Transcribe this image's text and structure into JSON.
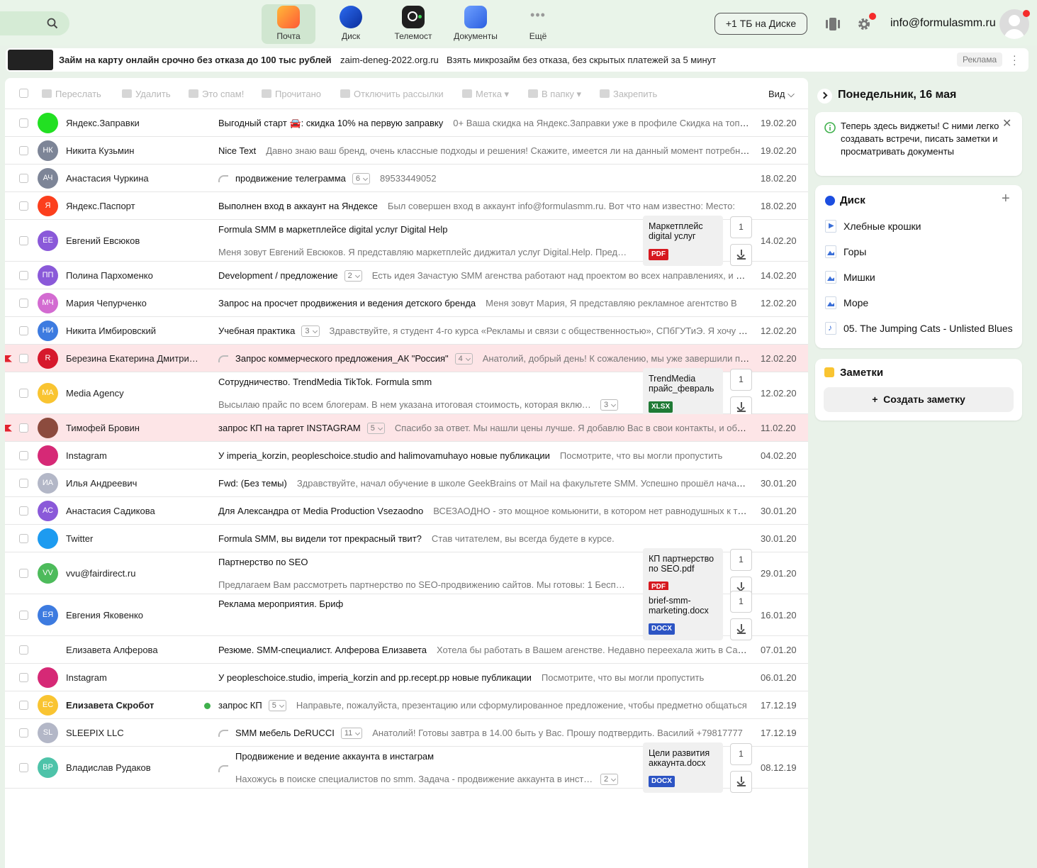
{
  "header": {
    "apps": [
      {
        "label": "Почта",
        "icon": "mail-icon",
        "active": true,
        "color": "#ff8a3d"
      },
      {
        "label": "Диск",
        "icon": "disk-icon",
        "active": false,
        "color": "#1c4ee0"
      },
      {
        "label": "Телемост",
        "icon": "telemost-icon",
        "active": false,
        "color": "#1f1f1f"
      },
      {
        "label": "Документы",
        "icon": "documents-icon",
        "active": false,
        "color": "#4c7cf2"
      },
      {
        "label": "Ещё",
        "icon": "more-dots-icon",
        "active": false,
        "color": "#999999"
      }
    ],
    "disk_offer": "+1 ТБ на Диске",
    "email": "info@formulasmm.ru"
  },
  "ad": {
    "title": "Займ на карту онлайн срочно без отказа до 100 тыс рублей",
    "domain": "zaim-deneg-2022.org.ru",
    "text": "Взять микрозайм без отказа, без скрытых платежей за 5 минут",
    "label": "Реклама"
  },
  "toolbar": {
    "forward": "Переслать",
    "delete": "Удалить",
    "spam": "Это спам!",
    "read": "Прочитано",
    "unsubscribe": "Отключить рассылки",
    "label": "Метка",
    "folder": "В папку",
    "pin": "Закрепить",
    "view": "Вид"
  },
  "emails": [
    {
      "sender": "Яндекс.Заправки",
      "subject": "Выгодный старт 🚘: скидка 10% на первую заправку",
      "snippet": "0+ Ваша скидка на Яндекс.Заправки уже в профиле Скидка на топливо",
      "date": "19.02.20",
      "initials": "",
      "avatar_color": "#22e022"
    },
    {
      "sender": "Никита Кузьмин",
      "subject": "Nice Text",
      "snippet": "Давно знаю ваш бренд, очень классные подходы и решения! Скажите, имеется ли на данный момент потребность",
      "date": "19.02.20",
      "initials": "НК",
      "avatar_color": "#7d8597"
    },
    {
      "sender": "Анастасия Чуркина",
      "subject": "продвижение телеграмма",
      "count": "6",
      "snippet": "89533449052",
      "date": "18.02.20",
      "initials": "АЧ",
      "avatar_color": "#7d8597",
      "reply": true
    },
    {
      "sender": "Яндекс.Паспорт",
      "subject": "Выполнен вход в аккаунт на Яндексе",
      "snippet": "Был совершен вход в аккаунт info@formulasmm.ru. Вот что нам известно: Место:",
      "date": "18.02.20",
      "initials": "Я",
      "avatar_color": "#fc3f1d"
    },
    {
      "sender": "Евгений Евсюков",
      "subject": "Formula SMM в маркетплейсе digital услуг Digital Help",
      "snippet": "Меня зовут Евгений Евсюков. Я представляю маркетплейс диджитал услуг Digital.Help. Предлагаем",
      "date": "14.02.20",
      "initials": "ЕЕ",
      "avatar_color": "#8a59d9",
      "attachment": {
        "name": "Маркетплейс digital услуг",
        "type": "PDF",
        "count": "1"
      }
    },
    {
      "sender": "Полина Пархоменко",
      "subject": "Development / предложение",
      "count": "2",
      "snippet": "Есть идея Зачастую SMM агенства работают над проектом во всех направлениях, и иногда",
      "date": "14.02.20",
      "initials": "ПП",
      "avatar_color": "#8a59d9"
    },
    {
      "sender": "Мария Чепурченко",
      "subject": "Запрос на просчет продвижения и ведения детского бренда",
      "snippet": "Меня зовут Мария, Я представляю рекламное агентство В",
      "date": "12.02.20",
      "initials": "МЧ",
      "avatar_color": "#d36bd1"
    },
    {
      "sender": "Никита Имбировский",
      "subject": "Учебная практика",
      "count": "3",
      "snippet": "Здравствуйте, я студент 4-го курса «Рекламы и связи с общественностью», СПбГУТиЭ. Я хочу пройти",
      "date": "12.02.20",
      "initials": "НИ",
      "avatar_color": "#3d7be0"
    },
    {
      "sender": "Березина Екатерина Дмитриевна",
      "subject": "Запрос коммерческого предложения_АК \"Россия\"",
      "count": "4",
      "snippet": "Анатолий, добрый день! К сожалению, мы уже завершили прием",
      "date": "12.02.20",
      "initials": "R",
      "avatar_color": "#d6182c",
      "reply": true,
      "flag": true,
      "red": true
    },
    {
      "sender": "Media Agency",
      "subject": "Сотрудничество. TrendMedia TikTok. Formula smm",
      "snippet": "Высылаю прайс по всем блогерам. В нем указана итоговая стоимость, которая включает",
      "count": "3",
      "date": "12.02.20",
      "initials": "MA",
      "avatar_color": "#f9c431",
      "attachment": {
        "name": "TrendMedia прайс_февраль",
        "type": "XLSX",
        "count": "1"
      }
    },
    {
      "sender": "Тимофей Бровин",
      "subject": "запрос КП на таргет INSTAGRAM",
      "count": "5",
      "snippet": "Спасибо за ответ. Мы нашли цены лучше. Я добавлю Вас в свои контакты, и обращусь",
      "date": "11.02.20",
      "initials": "",
      "avatar_color": "#8c4b3e",
      "flag": true,
      "red": true
    },
    {
      "sender": "Instagram",
      "subject": "У imperia_korzin, peopleschoice.studio and halimovamuhayo новые публикации",
      "snippet": "Посмотрите, что вы могли пропустить",
      "date": "04.02.20",
      "initials": "",
      "avatar_color": "#d62976"
    },
    {
      "sender": "Илья Андреевич",
      "subject": "Fwd: (Без темы)",
      "snippet": "Здравствуйте, начал обучение в школе GeekBrains от Mail на факультете SMM. Успешно прошёл начальный",
      "date": "30.01.20",
      "initials": "ИА",
      "avatar_color": "#b3b7c7"
    },
    {
      "sender": "Анастасия Садикова",
      "subject": "Для Александра от Media Production Vsezaodno",
      "snippet": "ВСЕЗАОДНО - это мощное комьюнити, в котором нет равнодушных к творчеству",
      "date": "30.01.20",
      "initials": "АС",
      "avatar_color": "#8a59d9"
    },
    {
      "sender": "Twitter",
      "subject": "Formula SMM, вы видели тот прекрасный твит?",
      "snippet": "Став читателем, вы всегда будете в курсе.",
      "date": "30.01.20",
      "initials": "",
      "avatar_color": "#1d9bf0"
    },
    {
      "sender": "vvu@fairdirect.ru",
      "subject": "Партнерство по SEO",
      "snippet": "Предлагаем Вам рассмотреть партнерство по SEO-продвижению сайтов. Мы готовы: 1 Бесплатно",
      "date": "29.01.20",
      "initials": "VV",
      "avatar_color": "#4dbb5b",
      "attachment": {
        "name": "КП партнерство по SEO.pdf",
        "type": "PDF",
        "count": "1"
      }
    },
    {
      "sender": "Евгения Яковенко",
      "subject": "Реклама мероприятия. Бриф",
      "snippet": "",
      "date": "16.01.20",
      "initials": "ЕЯ",
      "avatar_color": "#3d7be0",
      "attachment": {
        "name": "brief-smm-marketing.docx",
        "type": "DOCX",
        "count": "1"
      }
    },
    {
      "sender": "Елизавета Алферова",
      "subject": "Резюме. SMM-специалист. Алферова Елизавета",
      "snippet": "Хотела бы работать в Вашем агенстве. Недавно переехала жить в Санкт",
      "date": "07.01.20",
      "initials": "",
      "avatar_color": "#ffffff"
    },
    {
      "sender": "Instagram",
      "subject": "У peopleschoice.studio, imperia_korzin and pp.recept.pp новые публикации",
      "snippet": "Посмотрите, что вы могли пропустить",
      "date": "06.01.20",
      "initials": "",
      "avatar_color": "#d62976"
    },
    {
      "sender": "Елизавета Скробот",
      "subject": "запрос КП",
      "count": "5",
      "snippet": "Направьте, пожалуйста, презентацию или сформулированное предложение, чтобы предметно общаться",
      "date": "17.12.19",
      "initials": "ЕС",
      "avatar_color": "#f9c431",
      "unread": true
    },
    {
      "sender": "SLEEPIX LLC",
      "subject": "SMM мебель DeRUCCI",
      "count": "11",
      "snippet": "Анатолий! Готовы завтра в 14.00 быть у Вас. Прошу подтвердить. Василий +79817777",
      "date": "17.12.19",
      "initials": "SL",
      "avatar_color": "#b3b7c7",
      "reply": true
    },
    {
      "sender": "Владислав Рудаков",
      "subject": "Продвижение и ведение аккаунта в инстаграм",
      "snippet": "Нахожусь в поиске специалистов по smm. Задача - продвижение аккаунта в инстаграм",
      "count": "2",
      "date": "08.12.19",
      "initials": "ВР",
      "avatar_color": "#4ec3a9",
      "reply": true,
      "attachment": {
        "name": "Цели развития аккаунта.docx",
        "type": "DOCX",
        "count": "1"
      }
    }
  ],
  "sidebar": {
    "date": "Понедельник, 16 мая",
    "tip": "Теперь здесь виджеты! С ними легко создавать встречи, писать заметки и просматривать документы",
    "disk_title": "Диск",
    "files": [
      "Хлебные крошки",
      "Горы",
      "Мишки",
      "Море",
      "05. The Jumping Cats - Unlisted Blues"
    ],
    "notes_title": "Заметки",
    "create_note": "Создать заметку"
  }
}
